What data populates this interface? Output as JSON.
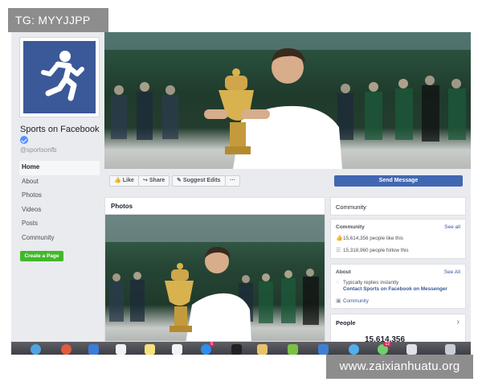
{
  "overlay": {
    "tag_text": "TG: MYYJJPP",
    "watermark_text": "www.zaixianhuatu.org"
  },
  "page": {
    "name": "Sports on Facebook",
    "handle": "@sportsonfb",
    "verified": true,
    "profile_icon": "running-person-icon",
    "brand_color": "#3b5998"
  },
  "sidebar": {
    "items": [
      {
        "label": "Home",
        "active": true
      },
      {
        "label": "About"
      },
      {
        "label": "Photos"
      },
      {
        "label": "Videos"
      },
      {
        "label": "Posts"
      },
      {
        "label": "Community"
      }
    ],
    "create_page_label": "Create a Page"
  },
  "actions": {
    "like_label": "Like",
    "share_label": "Share",
    "suggest_label": "Suggest Edits",
    "more_label": "···",
    "send_message_label": "Send Message"
  },
  "photos": {
    "title": "Photos"
  },
  "community_card": {
    "header": "Community",
    "subheader": "Community",
    "see_all": "See all",
    "likes_text": "15,614,356 people like this",
    "follows_text": "15,318,960 people follow this"
  },
  "about_card": {
    "title": "About",
    "see_all": "See All",
    "replies_text": "Typically replies instantly",
    "contact_text": "Contact Sports on Facebook on Messenger",
    "category_text": "Community"
  },
  "people_card": {
    "title": "People",
    "count_partial": "15,614,356"
  },
  "dock": {
    "icons": [
      "finder-icon",
      "safari-icon",
      "chrome-icon",
      "mail-icon",
      "calendar-icon",
      "notes-icon",
      "reminders-icon",
      "app-store-icon",
      "music-icon",
      "photos-icon",
      "messages-icon",
      "facetime-icon",
      "preview-icon"
    ],
    "badge_counts": [
      "6",
      "12"
    ]
  }
}
